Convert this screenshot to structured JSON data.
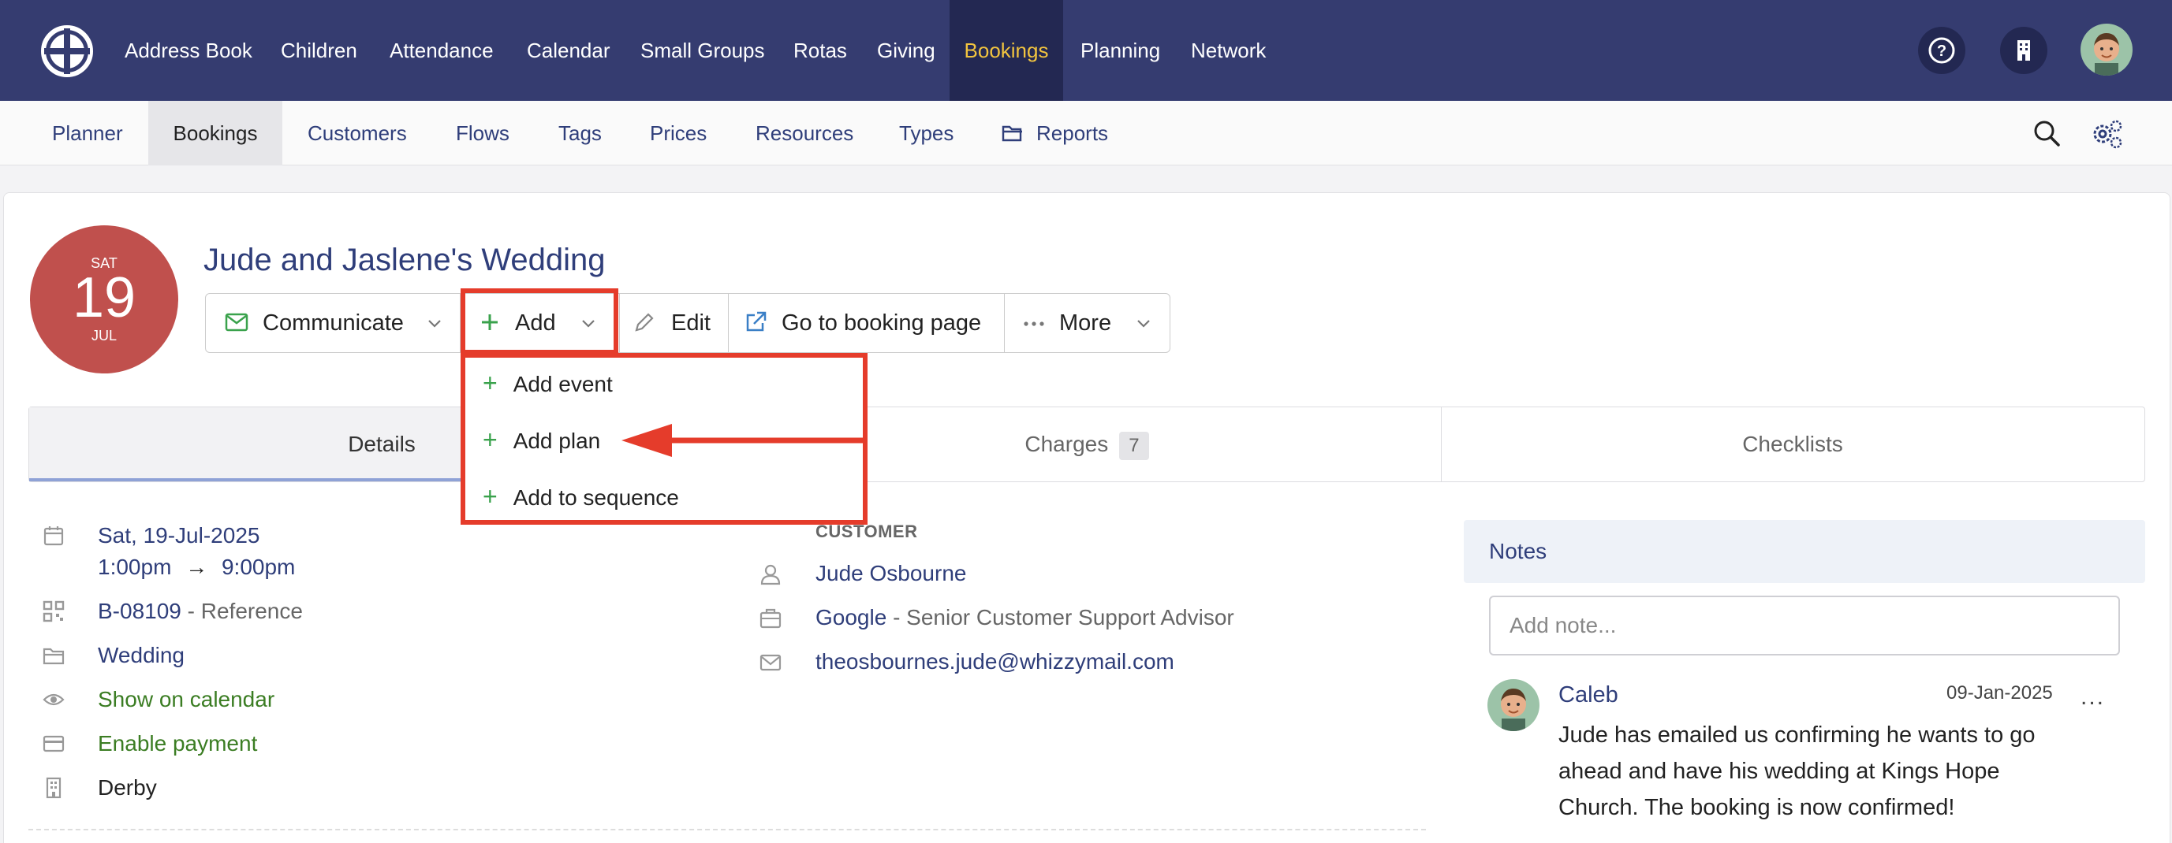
{
  "topnav": {
    "items": [
      "Address Book",
      "Children",
      "Attendance",
      "Calendar",
      "Small Groups",
      "Rotas",
      "Giving",
      "Bookings",
      "Planning",
      "Network"
    ],
    "active": "Bookings",
    "icons": [
      "help-icon",
      "building-icon",
      "user-avatar"
    ]
  },
  "subnav": {
    "items": [
      "Planner",
      "Bookings",
      "Customers",
      "Flows",
      "Tags",
      "Prices",
      "Resources",
      "Types",
      "Reports"
    ],
    "active": "Bookings",
    "icons": [
      "search-icon",
      "settings-icon"
    ]
  },
  "booking": {
    "date": {
      "dow": "SAT",
      "day": "19",
      "month": "JUL"
    },
    "title": "Jude and Jaslene's Wedding"
  },
  "actions": {
    "communicate": "Communicate",
    "add": "Add",
    "edit": "Edit",
    "go_to_booking": "Go to booking page",
    "more": "More"
  },
  "add_menu": {
    "items": [
      "Add event",
      "Add plan",
      "Add to sequence"
    ]
  },
  "tabs": {
    "details": "Details",
    "charges": "Charges",
    "charges_count": "7",
    "checklists": "Checklists"
  },
  "details": {
    "date": "Sat, 19-Jul-2025",
    "time_start": "1:00pm",
    "arrow": "→",
    "time_end": "9:00pm",
    "reference": "B-08109",
    "reference_label": " - Reference",
    "type": "Wedding",
    "show_calendar": "Show on calendar",
    "enable_payment": "Enable payment",
    "site": "Derby"
  },
  "customer": {
    "label": "CUSTOMER",
    "name": "Jude Osbourne",
    "company": "Google",
    "role": " - Senior Customer Support Advisor",
    "email": "theosbournes.jude@whizzymail.com"
  },
  "notes": {
    "title": "Notes",
    "placeholder": "Add note...",
    "entry": {
      "author": "Caleb",
      "date": "09-Jan-2025",
      "more": "...",
      "text": "Jude has emailed us confirming he wants to go ahead and have his wedding at Kings Hope Church. The booking is now confirmed!"
    }
  },
  "colors": {
    "topnav_bg": "#353c70",
    "active_nav": "#f2c43f",
    "date_circle": "#c0504d",
    "annotation": "#e53c2b",
    "link": "#2f3e7a",
    "green": "#3b7d23"
  }
}
